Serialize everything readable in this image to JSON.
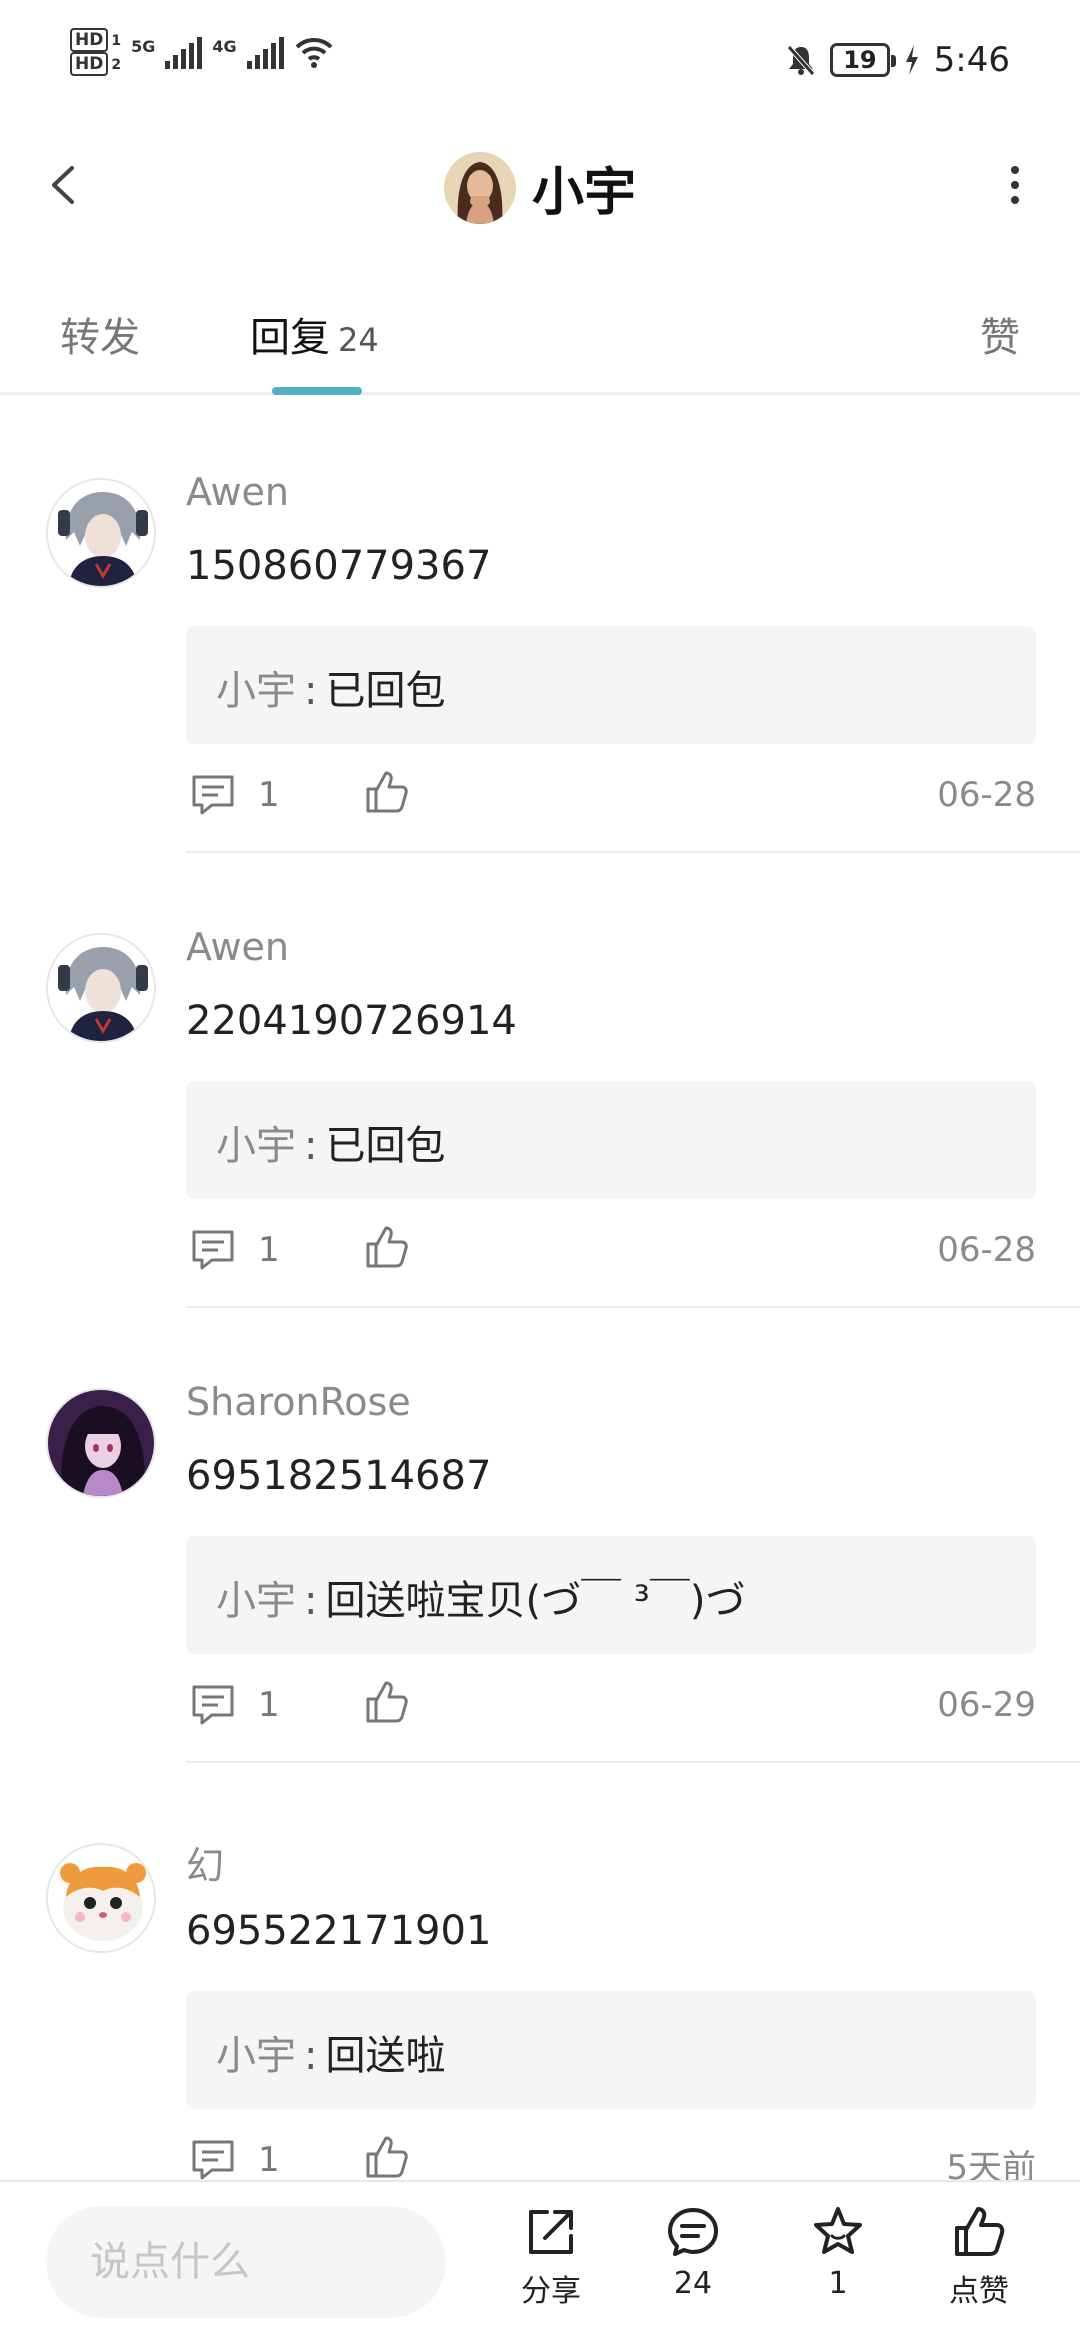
{
  "status_bar": {
    "hd1": "HD",
    "hd1_sub": "1",
    "hd2": "HD",
    "hd2_sub": "2",
    "net1": "5G",
    "net2": "4G",
    "battery": "19",
    "time": "5:46"
  },
  "header": {
    "title": "小宇",
    "accent": "#4fb0bf"
  },
  "tabs": {
    "forward": "转发",
    "reply": "回复",
    "reply_count": "24",
    "like": "赞"
  },
  "comments": [
    {
      "name": "Awen",
      "text": "150860779367",
      "reply_author": "小宇",
      "reply_sep": ":",
      "reply_text": "已回包",
      "reply_count": "1",
      "date": "06-28"
    },
    {
      "name": "Awen",
      "text": "2204190726914",
      "reply_author": "小宇",
      "reply_sep": ":",
      "reply_text": "已回包",
      "reply_count": "1",
      "date": "06-28"
    },
    {
      "name": "SharonRose",
      "text": "695182514687",
      "reply_author": "小宇",
      "reply_sep": ":",
      "reply_text": "回送啦宝贝(づ￣ ³￣)づ",
      "reply_count": "1",
      "date": "06-29"
    },
    {
      "name": "幻",
      "text": "695522171901",
      "reply_author": "小宇",
      "reply_sep": ":",
      "reply_text": "回送啦",
      "reply_count": "1",
      "date": "5天前"
    }
  ],
  "bottom_bar": {
    "input_placeholder": "说点什么",
    "share_label": "分享",
    "comments_count": "24",
    "favorites_count": "1",
    "like_label": "点赞"
  }
}
